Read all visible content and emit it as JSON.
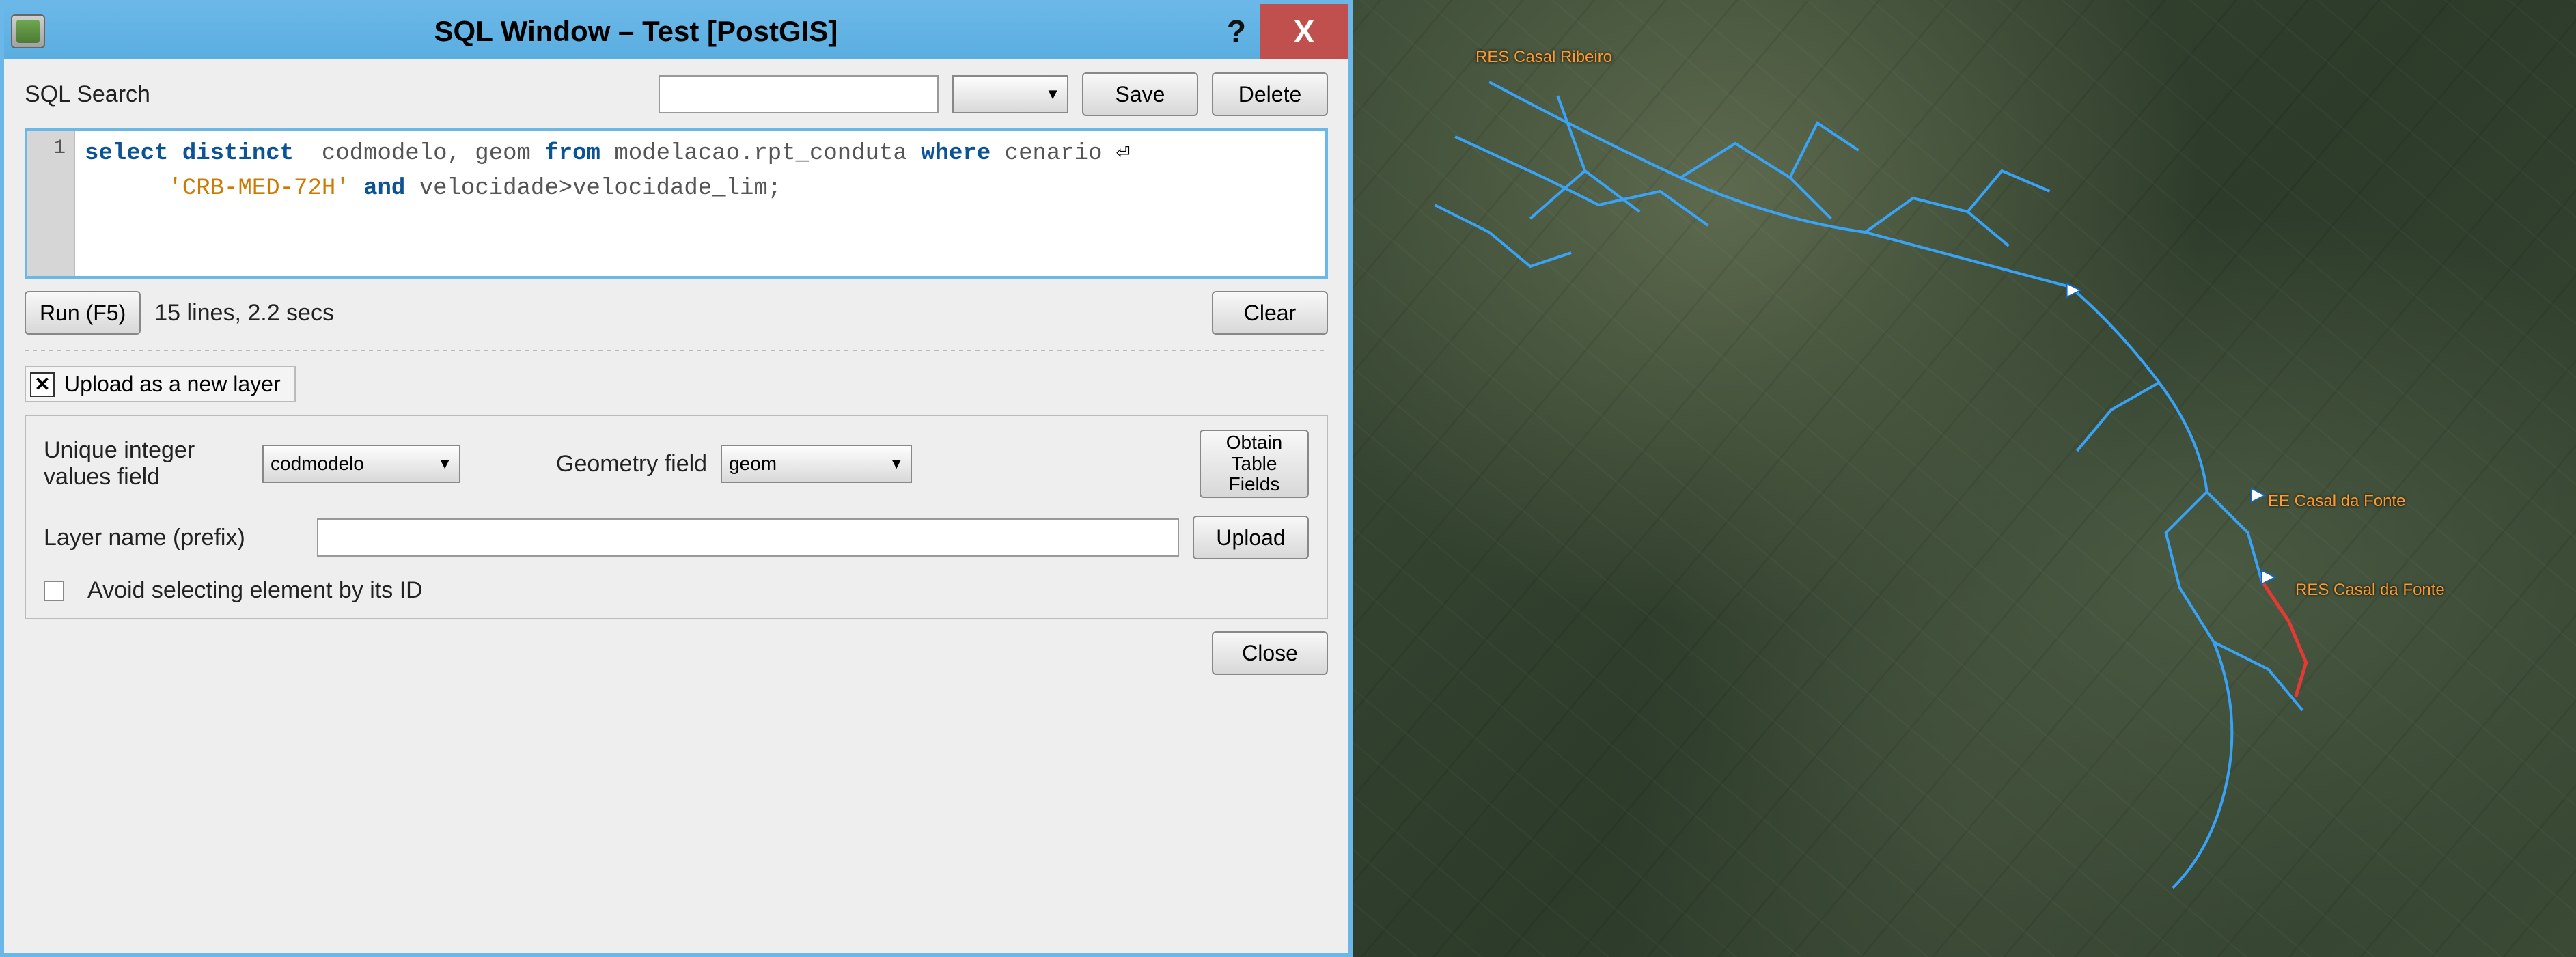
{
  "window": {
    "title": "SQL Window – Test [PostGIS]",
    "help_glyph": "?",
    "close_glyph": "X"
  },
  "search": {
    "label": "SQL Search",
    "value": "",
    "dropdown_value": "",
    "save_label": "Save",
    "delete_label": "Delete"
  },
  "sql": {
    "line_number": "1",
    "line1_pre": "select distinct",
    "line1_cols": "  codmodelo, geom ",
    "line1_from": "from",
    "line1_table": " modelacao.rpt_conduta ",
    "line1_where": "where",
    "line1_col2": " cenario ",
    "line1_wrap": "⏎",
    "line2_str": "'CRB-MED-72H'",
    "line2_and": " and ",
    "line2_rest": "velocidade>velocidade_lim;"
  },
  "run": {
    "run_label": "Run (F5)",
    "status": "15 lines, 2.2 secs",
    "clear_label": "Clear"
  },
  "layer": {
    "section_title": "Upload as a new layer",
    "uid_label": "Unique integer\nvalues field",
    "uid_value": "codmodelo",
    "geom_label": "Geometry field",
    "geom_value": "geom",
    "obtain_label": "Obtain\nTable\nFields",
    "prefix_label": "Layer name (prefix)",
    "prefix_value": "",
    "upload_label": "Upload",
    "avoid_label": "Avoid selecting element by its ID",
    "close_label": "Close"
  },
  "map": {
    "label1": "RES Casal Ribeiro",
    "label2": "EE Casal da Fonte",
    "label3": "RES Casal da Fonte"
  }
}
